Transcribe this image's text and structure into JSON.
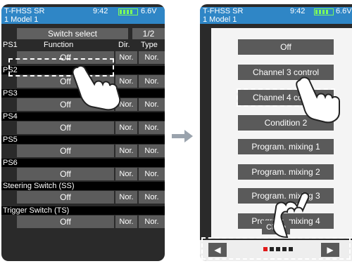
{
  "left": {
    "status": {
      "rx": "T-FHSS SR",
      "time": "9:42",
      "voltage": "6.6V",
      "model": "1  Model 1"
    },
    "header": {
      "title": "Switch select",
      "page": "1/2"
    },
    "columns": {
      "ps": "PS1",
      "function": "Function",
      "dir": "Dir.",
      "type": "Type"
    },
    "rows": [
      {
        "label": "",
        "function": "Off",
        "dir": "Nor.",
        "type": "Nor."
      },
      {
        "label": "PS2",
        "function": "Off",
        "dir": "Nor.",
        "type": "Nor."
      },
      {
        "label": "PS3",
        "function": "Off",
        "dir": "Nor.",
        "type": "Nor."
      },
      {
        "label": "PS4",
        "function": "Off",
        "dir": "Nor.",
        "type": "Nor."
      },
      {
        "label": "PS5",
        "function": "Off",
        "dir": "Nor.",
        "type": "Nor."
      },
      {
        "label": "PS6",
        "function": "Off",
        "dir": "Nor.",
        "type": "Nor."
      },
      {
        "label": "Steering Switch (SS)",
        "function": "Off",
        "dir": "Nor.",
        "type": "Nor."
      },
      {
        "label": "Trigger Switch (TS)",
        "function": "Off",
        "dir": "Nor.",
        "type": "Nor."
      }
    ]
  },
  "right": {
    "status": {
      "rx": "T-FHSS SR",
      "time": "9:42",
      "voltage": "6.6V",
      "model": "1  Model 1"
    },
    "options": [
      "Off",
      "Channel 3 control",
      "Channel 4 control",
      "Condition 2",
      "Program. mixing 1",
      "Program. mixing 2",
      "Program. mixing 3",
      "Program. mixing 4"
    ],
    "close": "Close",
    "nav": {
      "prev": "◀",
      "next": "▶",
      "pages": 5,
      "current_page": 1
    }
  },
  "colors": {
    "status_bar": "#2f86c6",
    "button": "#5c5c5c",
    "active_page": "#e11a1a"
  }
}
